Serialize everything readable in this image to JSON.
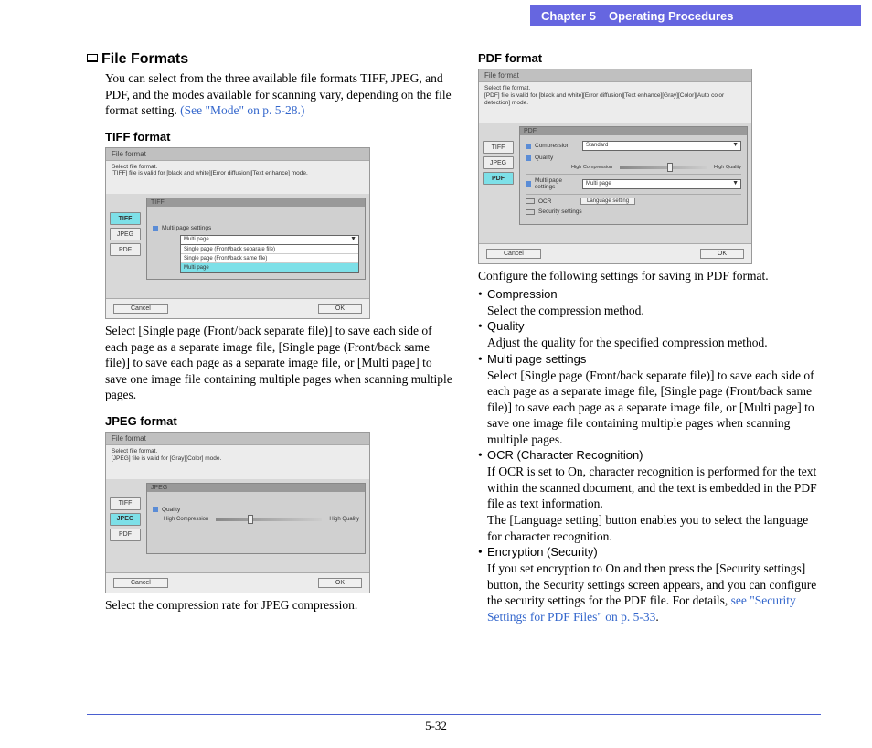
{
  "header": {
    "chapter": "Chapter 5",
    "title": "Operating Procedures"
  },
  "section": {
    "title": "File Formats",
    "intro": "You can select from the three available file formats TIFF, JPEG, and PDF, and the modes available for scanning vary, depending on the file format setting. ",
    "intro_link": "(See \"Mode\" on p. 5-28.)"
  },
  "tiff": {
    "heading": "TIFF format",
    "dialog_title": "File format",
    "help": "Select file format.\n[TIFF] file is valid for [black and white][Error diffusion][Text enhance] mode.",
    "tabs": [
      "TIFF",
      "JPEG",
      "PDF"
    ],
    "panel_title": "TIFF",
    "setting_label": "Multi page settings",
    "dropdown_value": "Multi page",
    "options": [
      "Single page (Front/back separate file)",
      "Single page (Front/back same file)",
      "Multi page"
    ],
    "cancel": "Cancel",
    "ok": "OK",
    "caption": "Select [Single page (Front/back separate file)] to save each side of each page as a separate image file, [Single page (Front/back same file)] to save each page as a separate image file, or [Multi page] to save one image file containing multiple pages when scanning multiple pages."
  },
  "jpeg": {
    "heading": "JPEG format",
    "dialog_title": "File format",
    "help": "Select file format.\n[JPEG] file is valid for [Gray][Color] mode.",
    "tabs": [
      "TIFF",
      "JPEG",
      "PDF"
    ],
    "panel_title": "JPEG",
    "setting_label": "Quality",
    "low": "High Compression",
    "high": "High Quality",
    "cancel": "Cancel",
    "ok": "OK",
    "caption": "Select the compression rate for JPEG compression."
  },
  "pdf": {
    "heading": "PDF format",
    "dialog_title": "File format",
    "help": "Select file format.\n[PDF] file is valid for [black and white][Error diffusion][Text enhance][Gray][Color][Auto color detection] mode.",
    "tabs": [
      "TIFF",
      "JPEG",
      "PDF"
    ],
    "panel_title": "PDF",
    "rows": {
      "compression_label": "Compression",
      "compression_value": "Standard",
      "quality_label": "Quality",
      "low": "High Compression",
      "high": "High Quality",
      "multipage_label": "Multi page settings",
      "multipage_value": "Multi page",
      "ocr_label": "OCR",
      "ocr_btn": "Language setting",
      "security_label": "Security settings"
    },
    "cancel": "Cancel",
    "ok": "OK",
    "caption_intro": "Configure the following settings for saving in PDF format.",
    "bullets": [
      {
        "label": "Compression",
        "desc": "Select the compression method."
      },
      {
        "label": "Quality",
        "desc": "Adjust the quality for the specified compression method."
      },
      {
        "label": "Multi page settings",
        "desc": "Select [Single page (Front/back separate file)] to save each side of each page as a separate image file, [Single page (Front/back same file)] to save each page as a separate image file, or [Multi page] to save one image file containing multiple pages when scanning multiple pages."
      },
      {
        "label": "OCR (Character Recognition)",
        "desc": "If OCR is set to On, character recognition is performed for the text within the scanned document, and the text is embedded in the PDF file as text information.",
        "desc2": "The [Language setting] button enables you to select the language for character recognition."
      },
      {
        "label": "Encryption (Security)",
        "desc": "If you set encryption to On and then press the [Security settings] button, the Security settings screen appears, and you can configure the security settings for the PDF file. For details, ",
        "link": "see \"Security Settings for PDF Files\" on p. 5-33",
        "tail": "."
      }
    ]
  },
  "page_number": "5-32"
}
